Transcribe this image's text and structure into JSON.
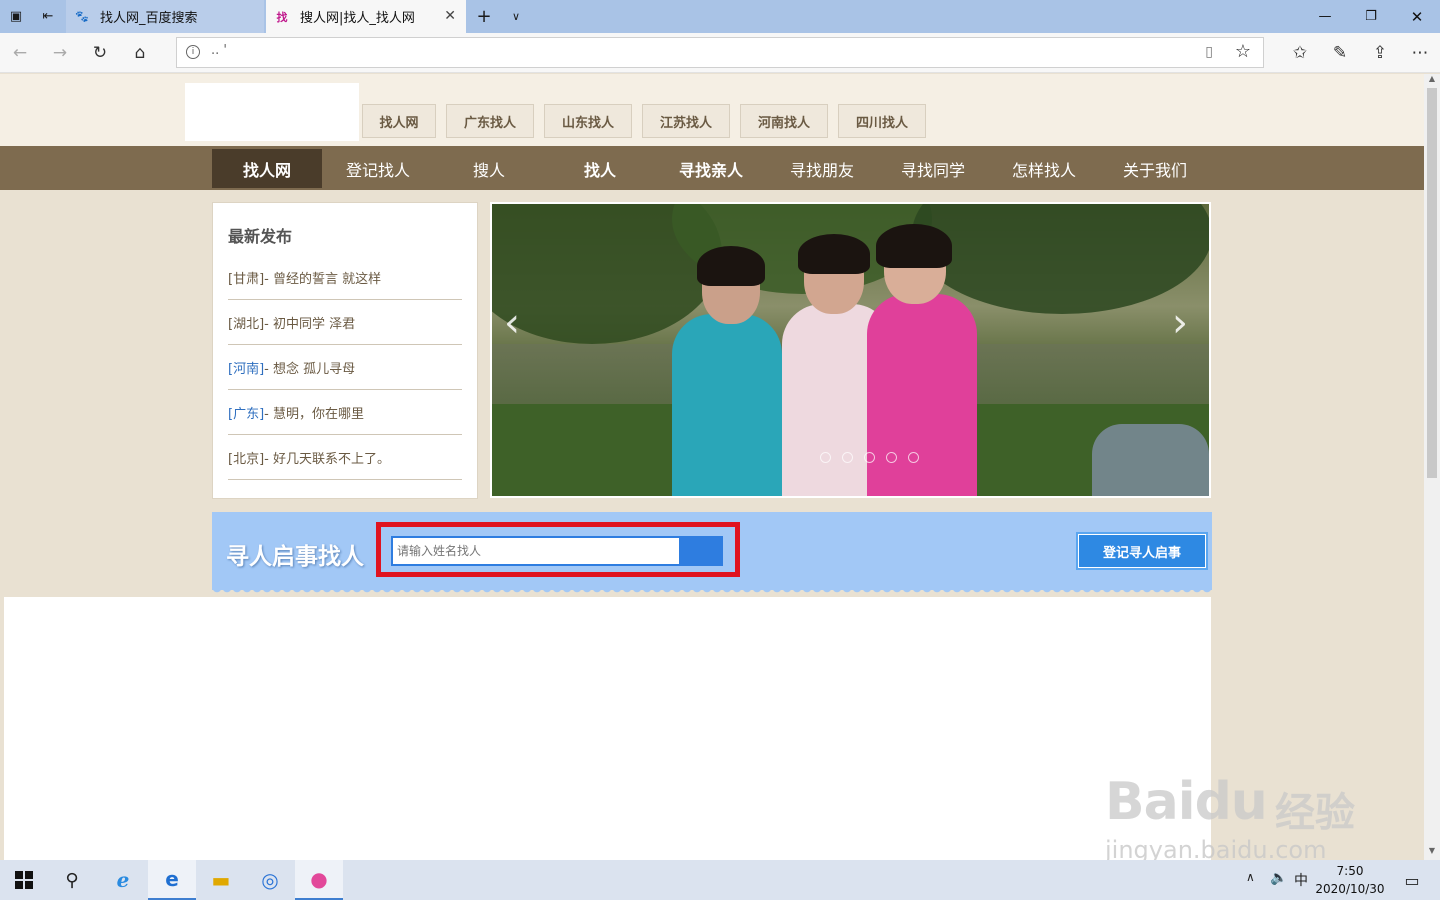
{
  "browser": {
    "tabs": [
      {
        "title": "找人网_百度搜索"
      },
      {
        "title": "搜人网|找人_找人网"
      }
    ],
    "address_url": ".. '"
  },
  "site": {
    "area_links": [
      "找人网",
      "广东找人",
      "山东找人",
      "江苏找人",
      "河南找人",
      "四川找人"
    ],
    "main_nav": [
      {
        "label": "找人网",
        "active": true
      },
      {
        "label": "登记找人"
      },
      {
        "label": "搜人"
      },
      {
        "label": "找人"
      },
      {
        "label": "寻找亲人"
      },
      {
        "label": "寻找朋友"
      },
      {
        "label": "寻找同学"
      },
      {
        "label": "怎样找人"
      },
      {
        "label": "关于我们"
      }
    ],
    "latest": {
      "title": "最新发布",
      "items": [
        {
          "region": "[甘肃]",
          "text": " - 曾经的誓言 就这样"
        },
        {
          "region": "[湖北]",
          "text": " - 初中同学 泽君"
        },
        {
          "region": "[河南]",
          "text": " - 想念 孤儿寻母"
        },
        {
          "region": "[广东]",
          "text": " - 慧明，你在哪里"
        },
        {
          "region": "[北京]",
          "text": " - 好几天联系不上了。"
        }
      ]
    },
    "search": {
      "title": "寻人启事找人",
      "placeholder": "请输入姓名找人",
      "register_button": "登记寻人启事"
    }
  },
  "taskbar": {
    "time": "7:50",
    "date": "2020/10/30",
    "ime": "中"
  },
  "watermark": {
    "brand": "Bai",
    "brand2": "du",
    "cn": "经验",
    "url": "jingyan.baidu.com"
  }
}
